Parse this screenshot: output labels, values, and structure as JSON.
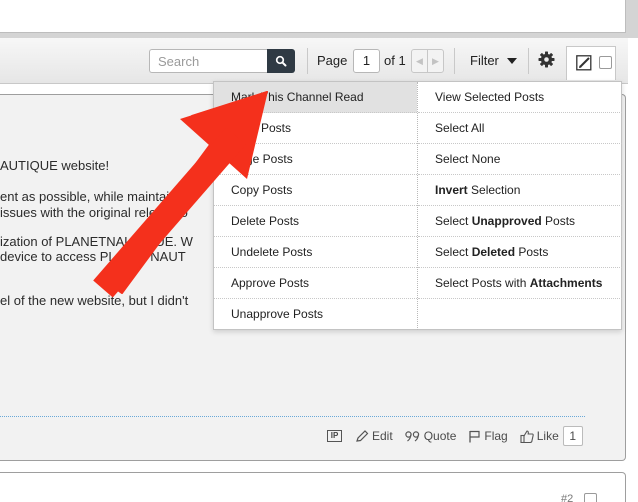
{
  "toolbar": {
    "search_placeholder": "Search",
    "page_label": "Page",
    "page_value": "1",
    "of_label": "of 1",
    "filter_label": "Filter"
  },
  "post1": {
    "text_lines": [
      "AUTIQUE website!",
      "ent as possible, while maintaining",
      "issues with the original release o",
      "ization of PLANETNAUTIQUE. W",
      "device to access PLANETNAUT",
      "el of the new website, but I didn't"
    ],
    "actions": {
      "ip_label": "IP",
      "edit_label": "Edit",
      "quote_label": "Quote",
      "flag_label": "Flag",
      "like_label": "Like",
      "like_count": "1"
    }
  },
  "post2": {
    "post_number": "#2"
  },
  "menu": {
    "left": [
      "Mark This Channel Read",
      "Posts",
      "rge Posts",
      "Copy Posts",
      "Delete Posts",
      "Undelete Posts",
      "Approve Posts",
      "Unapprove Posts"
    ],
    "right": [
      {
        "pre": "View Selected Posts",
        "bold": "",
        "post": ""
      },
      {
        "pre": "Select All",
        "bold": "",
        "post": ""
      },
      {
        "pre": "Select None",
        "bold": "",
        "post": ""
      },
      {
        "pre": "",
        "bold": "Invert",
        "post": " Selection"
      },
      {
        "pre": "Select ",
        "bold": "Unapproved",
        "post": " Posts"
      },
      {
        "pre": "Select ",
        "bold": "Deleted",
        "post": " Posts"
      },
      {
        "pre": "Select Posts with ",
        "bold": "Attachments",
        "post": ""
      }
    ]
  },
  "colors": {
    "arrow": "#f4301c",
    "search_button": "#2f3a44",
    "divider": "#6aa9d8",
    "menu_hover": "#e1e1e1"
  }
}
